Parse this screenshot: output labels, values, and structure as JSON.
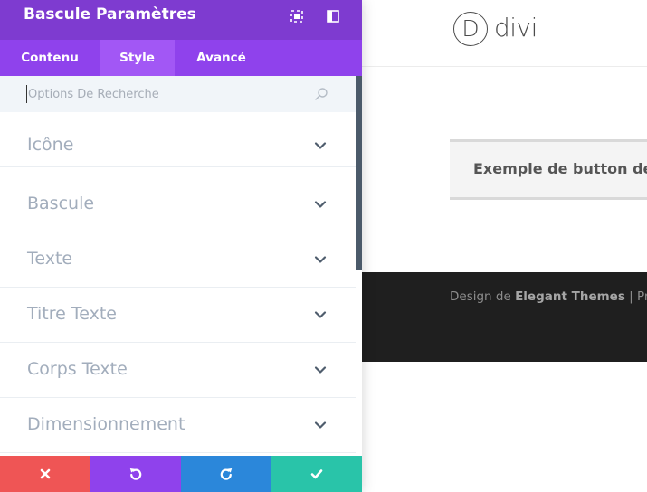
{
  "panel": {
    "title": "Bascule Paramètres",
    "header_color": "#7e3bd0",
    "tabs": [
      {
        "label": "Contenu",
        "active": false
      },
      {
        "label": "Style",
        "active": true
      },
      {
        "label": "Avancé",
        "active": false
      }
    ],
    "search": {
      "value": "",
      "placeholder": "Options De Recherche"
    },
    "toggles": [
      {
        "label": "Icône"
      },
      {
        "label": "Bascule"
      },
      {
        "label": "Texte"
      },
      {
        "label": "Titre Texte"
      },
      {
        "label": "Corps Texte"
      },
      {
        "label": "Dimensionnement"
      }
    ],
    "actions": [
      {
        "name": "cancel",
        "icon": "close-icon",
        "color": "#ef5555"
      },
      {
        "name": "undo",
        "icon": "undo-icon",
        "color": "#8f42ec"
      },
      {
        "name": "redo",
        "icon": "redo-icon",
        "color": "#2b87da"
      },
      {
        "name": "save",
        "icon": "check-icon",
        "color": "#29c4a9"
      }
    ]
  },
  "preview": {
    "logo_letter": "D",
    "logo_text": "divi",
    "toggle_title": "Exemple de button de bascule",
    "footer": {
      "prefix": "Design de ",
      "brand": "Elegant Themes",
      "suffix": " | Propulsé par WordPress"
    }
  }
}
